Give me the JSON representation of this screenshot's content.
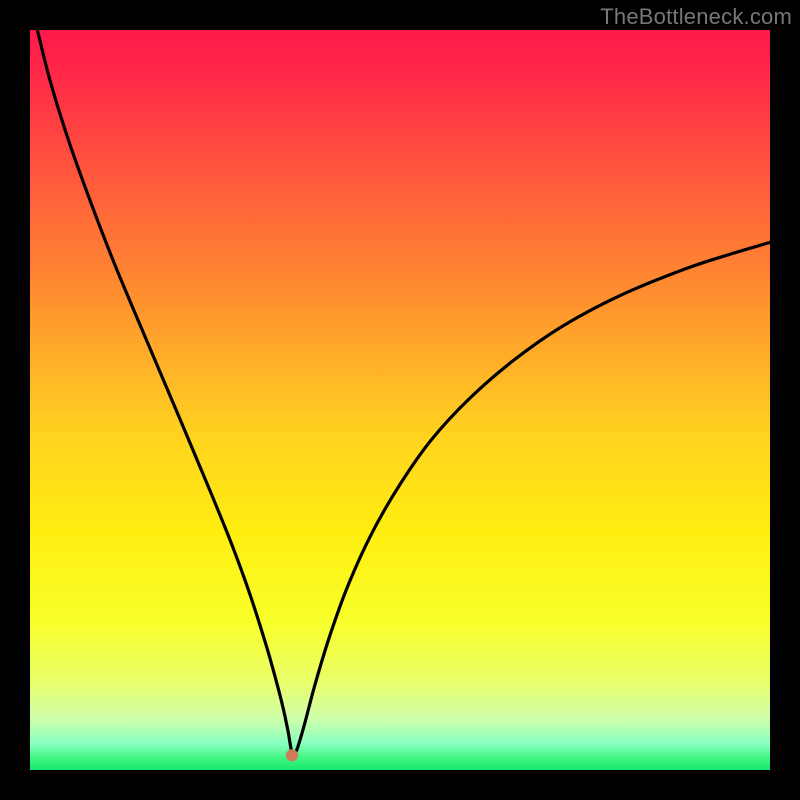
{
  "watermark": "TheBottleneck.com",
  "chart_data": {
    "type": "line",
    "title": "",
    "xlabel": "",
    "ylabel": "",
    "xlim": [
      0,
      100
    ],
    "ylim": [
      0,
      100
    ],
    "grid": false,
    "legend": false,
    "gradient_stops": [
      {
        "offset": 0.0,
        "color": "#ff1a4a"
      },
      {
        "offset": 0.06,
        "color": "#ff2847"
      },
      {
        "offset": 0.15,
        "color": "#ff4740"
      },
      {
        "offset": 0.25,
        "color": "#ff6a38"
      },
      {
        "offset": 0.35,
        "color": "#ff8c30"
      },
      {
        "offset": 0.45,
        "color": "#ffb028"
      },
      {
        "offset": 0.55,
        "color": "#ffd31f"
      },
      {
        "offset": 0.68,
        "color": "#ffee10"
      },
      {
        "offset": 0.8,
        "color": "#f8ff2a"
      },
      {
        "offset": 0.88,
        "color": "#e9ff6a"
      },
      {
        "offset": 0.93,
        "color": "#d0ffaa"
      },
      {
        "offset": 0.965,
        "color": "#86ffc0"
      },
      {
        "offset": 0.985,
        "color": "#3cf57e"
      },
      {
        "offset": 1.0,
        "color": "#18e873"
      }
    ],
    "series": [
      {
        "name": "bottleneck-curve",
        "x": [
          1.0,
          2.7,
          5.1,
          8.1,
          11.5,
          15.4,
          19.6,
          24.3,
          27.3,
          29.7,
          31.9,
          33.2,
          34.2,
          34.9,
          35.4,
          36.0,
          37.1,
          38.5,
          40.5,
          43.0,
          46.2,
          50.0,
          54.3,
          59.5,
          65.4,
          72.0,
          79.7,
          88.5,
          94.6,
          100.0
        ],
        "y": [
          100.0,
          93.2,
          85.4,
          77.0,
          68.2,
          58.9,
          49.0,
          37.8,
          30.4,
          23.8,
          16.9,
          12.3,
          8.4,
          5.1,
          2.4,
          2.6,
          6.2,
          11.5,
          18.1,
          25.0,
          32.0,
          38.6,
          44.7,
          50.3,
          55.4,
          60.0,
          64.1,
          67.7,
          69.7,
          71.3
        ]
      }
    ],
    "marker": {
      "x": 35.4,
      "y": 2.0,
      "r": 6,
      "color": "#d07a58"
    }
  }
}
